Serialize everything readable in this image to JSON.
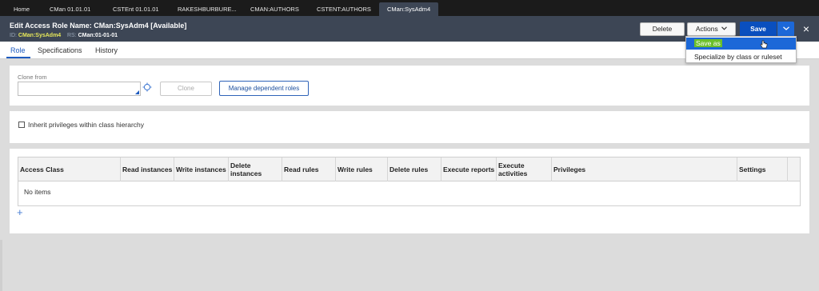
{
  "tabs": [
    {
      "label": "Home"
    },
    {
      "label": "CMan 01.01.01"
    },
    {
      "label": "CSTEnt 01.01.01"
    },
    {
      "label": "RAKESHBURBURE..."
    },
    {
      "label": "CMAN:AUTHORS"
    },
    {
      "label": "CSTENT:AUTHORS"
    },
    {
      "label": "CMan:SysAdm4",
      "active": true
    }
  ],
  "header": {
    "title": "Edit  Access Role Name: CMan:SysAdm4 [Available]",
    "id_label": "ID:",
    "id_value": "CMan:SysAdm4",
    "rs_label": "RS:",
    "rs_value": "CMan:01-01-01"
  },
  "toolbar": {
    "delete_label": "Delete",
    "actions_label": "Actions",
    "save_label": "Save",
    "close_icon": "×"
  },
  "subtabs": [
    {
      "label": "Role",
      "active": true
    },
    {
      "label": "Specifications"
    },
    {
      "label": "History"
    }
  ],
  "clone": {
    "field_label": "Clone from",
    "field_value": "",
    "clone_button": "Clone",
    "manage_button": "Manage dependent roles"
  },
  "inherit": {
    "label": "Inherit privileges within class hierarchy",
    "checked": false
  },
  "table": {
    "columns": [
      "Access Class",
      "Read instances",
      "Write instances",
      "Delete instances",
      "Read rules",
      "Write rules",
      "Delete rules",
      "Execute reports",
      "Execute activities",
      "Privileges",
      "Settings"
    ],
    "empty_text": "No items",
    "add_icon": "+"
  },
  "actions_menu": {
    "items": [
      "Save as",
      "Specialize by class or ruleset"
    ],
    "highlighted": "Save as"
  },
  "colors": {
    "header_bg": "#3d4655",
    "save_blue": "#0a4fbe",
    "menu_highlight": "#1c68d8",
    "id_yellow": "#e7e85a",
    "save_as_green": "#6bbf2a"
  }
}
